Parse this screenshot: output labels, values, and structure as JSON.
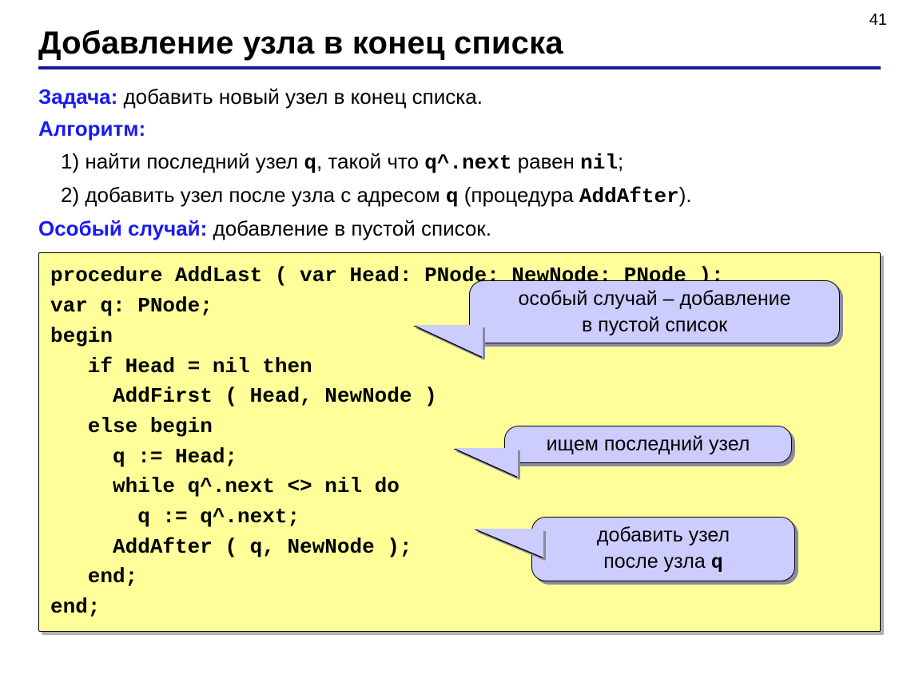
{
  "page_number": "41",
  "title": "Добавление узла в конец списка",
  "task": {
    "label": "Задача:",
    "text": "  добавить новый узел в конец списка."
  },
  "algorithm": {
    "label": "Алгоритм:",
    "items": [
      {
        "num": "1) ",
        "text_a": "найти последний узел ",
        "q": "q",
        "text_b": ", такой что ",
        "qnext": "q^.next",
        "text_c": " равен ",
        "nil": "nil",
        "text_d": ";"
      },
      {
        "num": "2) ",
        "text_a": "добавить узел после узла с адресом ",
        "q": "q",
        "text_b": " (процедура ",
        "proc": "AddAfter",
        "text_c": ")."
      }
    ]
  },
  "special": {
    "label": "Особый случай:",
    "text": " добавление в пустой список."
  },
  "code": {
    "l1": "procedure AddLast ( var Head: PNode; NewNode: PNode );",
    "l2": "var q: PNode;",
    "l3": "begin",
    "l4": "   if Head = nil then",
    "l5": "     AddFirst ( Head, NewNode )",
    "l6": "   else begin",
    "l7": "     q := Head;",
    "l8": "     while q^.next <> nil do",
    "l9": "       q := q^.next;",
    "l10": "     AddAfter ( q, NewNode );",
    "l11": "   end;",
    "l12": "end;"
  },
  "callouts": {
    "c1a": "особый  случай – добавление",
    "c1b": "в пустой список",
    "c2": "ищем последний узел",
    "c3a": "добавить  узел",
    "c3b_pre": "после узла ",
    "c3b_q": "q"
  }
}
